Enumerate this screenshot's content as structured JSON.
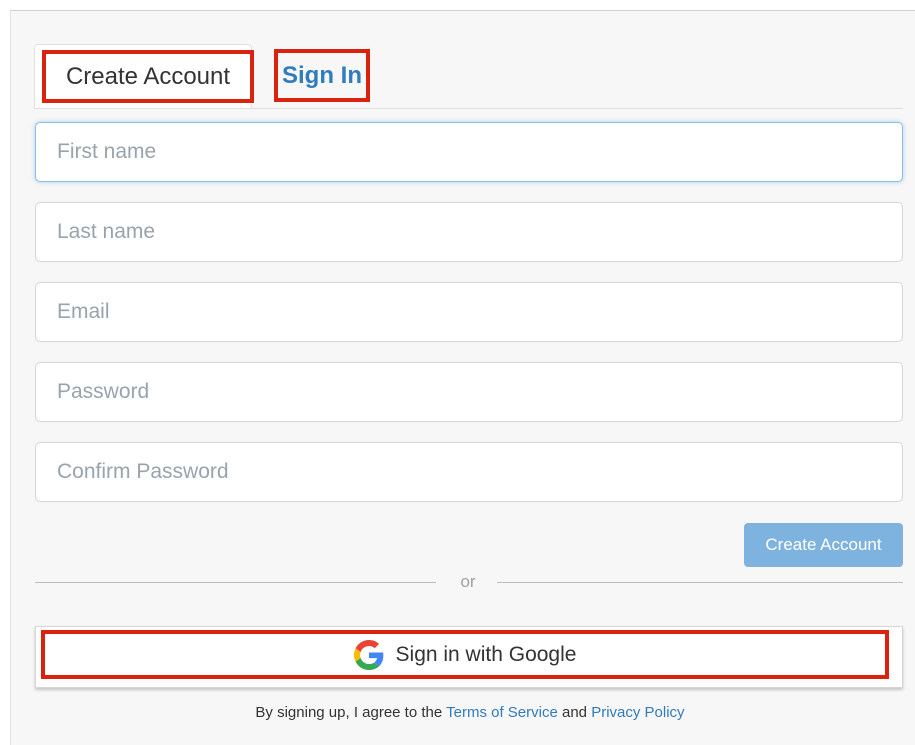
{
  "tabs": {
    "create_account": "Create Account",
    "sign_in": "Sign In"
  },
  "form": {
    "first_name": {
      "value": "",
      "placeholder": "First name"
    },
    "last_name": {
      "value": "",
      "placeholder": "Last name"
    },
    "email": {
      "value": "",
      "placeholder": "Email"
    },
    "password": {
      "value": "",
      "placeholder": "Password"
    },
    "confirm_password": {
      "value": "",
      "placeholder": "Confirm Password"
    },
    "submit_label": "Create Account"
  },
  "divider": {
    "text": "or"
  },
  "google": {
    "label": "Sign in with Google",
    "icon": "google-g-icon"
  },
  "legal": {
    "prefix": "By signing up, I agree to the",
    "terms_link": "Terms of Service",
    "conjunction": "and",
    "privacy_link": "Privacy Policy"
  },
  "colors": {
    "link": "#2f7cbf",
    "primary_button": "#7fb3df",
    "highlight": "#d9230f"
  }
}
